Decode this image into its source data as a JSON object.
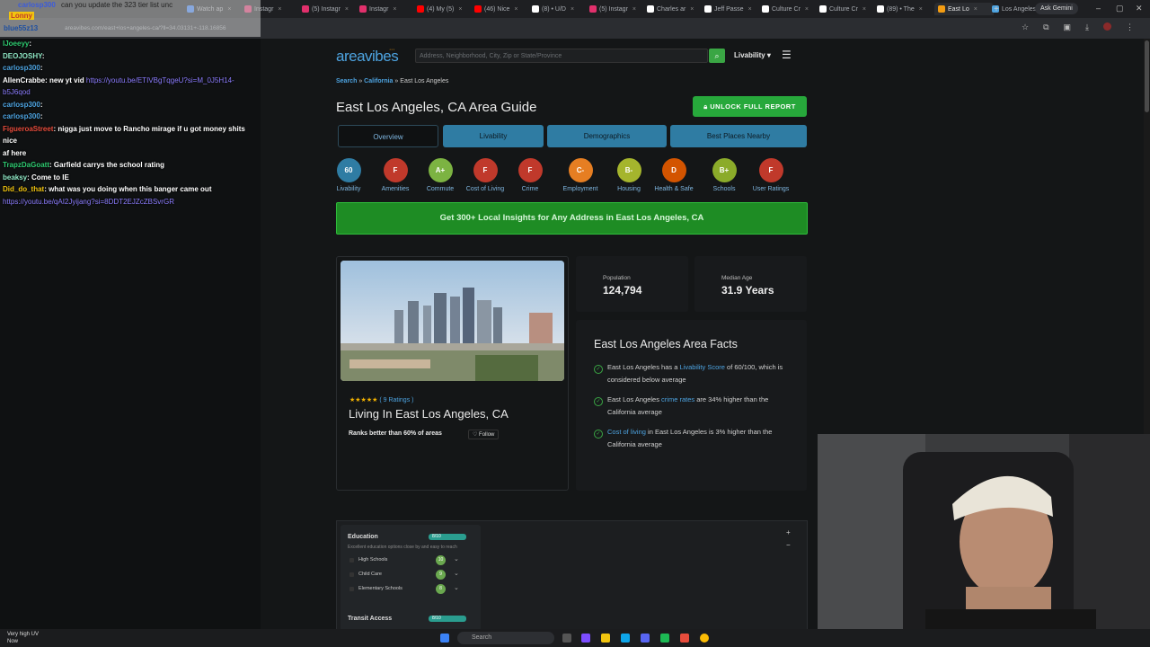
{
  "browser": {
    "tabs": [
      {
        "label": "Watch ap",
        "color": "#3b82f6"
      },
      {
        "label": "Instagr",
        "color": "#e1306c"
      },
      {
        "label": "(5) Instagr",
        "color": "#e1306c"
      },
      {
        "label": "Instagr",
        "color": "#e1306c"
      },
      {
        "label": "(4) My (5)",
        "color": "#ff0000"
      },
      {
        "label": "(46) Nice",
        "color": "#ff0000"
      },
      {
        "label": "(8) • U/D",
        "color": "#ffffff"
      },
      {
        "label": "(5) Instagr",
        "color": "#e1306c"
      },
      {
        "label": "Charles ar",
        "color": "#ffffff"
      },
      {
        "label": "Jeff Passe",
        "color": "#ffffff"
      },
      {
        "label": "Culture Cr",
        "color": "#ffffff"
      },
      {
        "label": "Culture Cr",
        "color": "#ffffff"
      },
      {
        "label": "(89) • The",
        "color": "#ffffff"
      },
      {
        "label": "East Lo",
        "color": "#f39c12",
        "active": true
      },
      {
        "label": "Los Angeles",
        "color": "#4da3e0"
      }
    ],
    "new_tab": "+",
    "gemini": "Ask Gemini",
    "url": "areavibes.com/east+los+angeles-ca/?ll=34.03131+-118.16856"
  },
  "chat": {
    "top": {
      "user1": "carlosp300",
      "msg1": "can you update the 323 tier list unc",
      "user2": "Lonny",
      "user3": "blue55z13"
    },
    "lines": [
      {
        "user": "IJoeeyy",
        "color": "#2ecc71",
        "text": ":"
      },
      {
        "user": "DEOJOSHY",
        "color": "#8ee6c4",
        "text": ":"
      },
      {
        "user": "carlosp300",
        "color": "#4da3e0",
        "text": ":"
      },
      {
        "user": "AllenCrabbe",
        "color": "#ffffff",
        "text": ": new yt vid ",
        "link": "https://youtu.be/ETIVBgTqgeU?si=M_0J5H14-"
      },
      {
        "user": "",
        "color": "#8c7dff",
        "text": "",
        "link": "b5J6qod"
      },
      {
        "user": "carlosp300",
        "color": "#4da3e0",
        "text": ":"
      },
      {
        "user": "carlosp300",
        "color": "#4da3e0",
        "text": ":"
      },
      {
        "user": "FigueroaStreet",
        "color": "#e74c3c",
        "text": ": nigga just move to Rancho mirage if u got money shits nice"
      },
      {
        "user": "",
        "color": "#ffffff",
        "text": "af here"
      },
      {
        "user": "TrapzDaGoatt",
        "color": "#2ecc71",
        "text": ": Garfield carrys the school rating"
      },
      {
        "user": "beaksy",
        "color": "#8ee6c4",
        "text": ": Come to IE"
      },
      {
        "user": "Did_do_that",
        "color": "#f1c40f",
        "text": ": what was you doing when this banger came out"
      },
      {
        "user": "",
        "color": "#8c7dff",
        "text": "",
        "link": "https://youtu.be/qAI2Jyijang?si=8DDT2EJZcZBSvrGR"
      }
    ]
  },
  "site": {
    "logo": "areavibes",
    "search_placeholder": "Address, Neighborhood, City, Zip or State/Province",
    "livability_menu": "Livability ▾",
    "breadcrumb": {
      "search": "Search",
      "sep1": "»",
      "state": "California",
      "sep2": "»",
      "current": "East Los Angeles"
    },
    "title": "East Los Angeles, CA Area Guide",
    "unlock": "UNLOCK FULL REPORT",
    "tabs": [
      "Overview",
      "Livability",
      "Demographics",
      "Best Places Nearby"
    ],
    "grades": [
      {
        "grade": "60",
        "label": "Livability",
        "color": "#2f7ca3"
      },
      {
        "grade": "F",
        "label": "Amenities",
        "color": "#c0392b"
      },
      {
        "grade": "A+",
        "label": "Commute",
        "color": "#7cb342"
      },
      {
        "grade": "F",
        "label": "Cost of Living",
        "color": "#c0392b"
      },
      {
        "grade": "F",
        "label": "Crime",
        "color": "#c0392b"
      },
      {
        "grade": "C-",
        "label": "Employment",
        "color": "#e67e22"
      },
      {
        "grade": "B-",
        "label": "Housing",
        "color": "#a5b52d"
      },
      {
        "grade": "D",
        "label": "Health & Safe",
        "color": "#d35400"
      },
      {
        "grade": "B+",
        "label": "Schools",
        "color": "#8bab2a"
      },
      {
        "grade": "F",
        "label": "User Ratings",
        "color": "#c0392b"
      }
    ],
    "insights_banner": "Get 300+ Local Insights for Any Address in East Los Angeles, CA",
    "card": {
      "stars": "★★★★★",
      "ratings_pre": "( ",
      "ratings": "9 Ratings",
      "ratings_post": " )",
      "heading": "Living In East Los Angeles, CA",
      "ranks": "Ranks better than 60% of areas",
      "follow": "♡ Follow"
    },
    "population": {
      "label": "Population",
      "value": "124,794"
    },
    "median_age": {
      "label": "Median Age",
      "value": "31.9 Years"
    },
    "facts": {
      "title": "East Los Angeles Area Facts",
      "f1a": "East Los Angeles has a ",
      "f1link": "Livability Score",
      "f1b": " of 60/100, which is considered below average",
      "f2link": "crime rates",
      "f2a": "East Los Angeles ",
      "f2b": " are 34% higher than the California average",
      "f3link": "Cost of living",
      "f3b": " in East Los Angeles is 3% higher than the California average"
    },
    "education": {
      "title": "Education",
      "badge": "8/10",
      "desc": "Excellent education options close by and easy to reach",
      "rows": [
        {
          "name": "High Schools",
          "score": "10"
        },
        {
          "name": "Child Care",
          "score": "9"
        },
        {
          "name": "Elementary Schools",
          "score": "8"
        }
      ],
      "transit_title": "Transit Access",
      "transit_badge": "8/10"
    },
    "zoom": {
      "in": "+",
      "out": "−"
    }
  },
  "taskbar": {
    "weather_line1": "Very high UV",
    "weather_line2": "Now",
    "search": "Search"
  }
}
